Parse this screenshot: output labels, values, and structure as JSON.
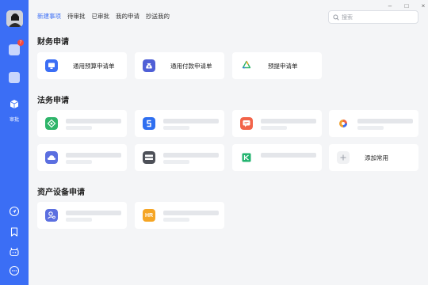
{
  "sidebar": {
    "badge_count": "7",
    "approval_label": "审批"
  },
  "tabs": [
    {
      "label": "新建事项",
      "active": true
    },
    {
      "label": "待审批",
      "active": false
    },
    {
      "label": "已审批",
      "active": false
    },
    {
      "label": "我的申请",
      "active": false
    },
    {
      "label": "抄送我的",
      "active": false
    }
  ],
  "search": {
    "placeholder": "搜索"
  },
  "window_controls": {
    "minimize": "–",
    "maximize": "□",
    "close": "×"
  },
  "sections": {
    "finance": {
      "title": "财务申请",
      "items": [
        {
          "label": "通用预算申请单",
          "icon": "monitor-icon",
          "color": "#3b6ef5"
        },
        {
          "label": "通用付款申请单",
          "icon": "money-bag-icon",
          "color": "#4f5fd6"
        },
        {
          "label": "预提申请单",
          "icon": "recycle-icon",
          "color": "#2fb56a"
        }
      ]
    },
    "legal": {
      "title": "法务申请",
      "items": [
        {
          "icon": "green-app-icon",
          "color": "#2fb56a"
        },
        {
          "icon": "blue-s-app-icon",
          "color": "#2f6ff0"
        },
        {
          "icon": "red-chat-app-icon",
          "color": "#f2644a"
        },
        {
          "icon": "colorful-app-icon",
          "color": "#f0a030"
        },
        {
          "icon": "cloud-app-icon",
          "color": "#5b6fe0"
        },
        {
          "icon": "pay-app-icon",
          "color": "#4d5058"
        },
        {
          "icon": "green-k-app-icon",
          "color": "#21b36e"
        },
        {
          "label": "添加常用",
          "icon": "plus-icon",
          "color": "#f0f1f3"
        }
      ]
    },
    "assets": {
      "title": "资产设备申请",
      "items": [
        {
          "icon": "person-search-icon",
          "color": "#5b6fe0"
        },
        {
          "icon": "hr-app-icon",
          "color": "#f5a524",
          "text": "HR"
        }
      ]
    }
  }
}
